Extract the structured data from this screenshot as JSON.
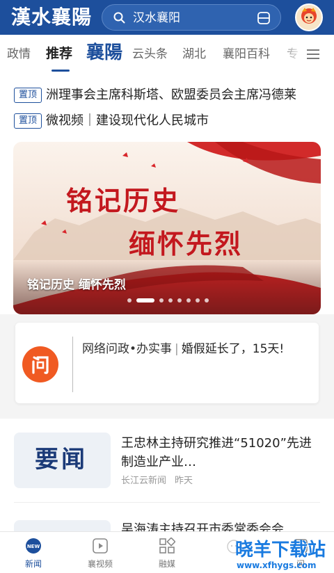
{
  "header": {
    "logo": "漢水襄陽",
    "search_text": "汉水襄阳"
  },
  "tabs": [
    {
      "label": "政情"
    },
    {
      "label": "推荐"
    },
    {
      "label": "襄陽"
    },
    {
      "label": "云头条"
    },
    {
      "label": "湖北"
    },
    {
      "label": "襄阳百科"
    },
    {
      "label": "专"
    }
  ],
  "active_tab": "推荐",
  "pinned": [
    {
      "badge": "置顶",
      "title": "洲理事会主席科斯塔、欧盟委员会主席冯德莱"
    },
    {
      "badge": "置顶",
      "title": "微视频｜建设现代化人民城市"
    }
  ],
  "banner": {
    "line1": "铭记历史",
    "line2": "缅怀先烈",
    "caption": "铭记历史 缅怀先烈",
    "slide_count": 8,
    "active_slide": 2
  },
  "wenzheng": {
    "logo_char": "问",
    "source": "网络问政•办实事",
    "separator": "|",
    "text": "婚假延长了，15天!"
  },
  "news": [
    {
      "thumb_text": "要闻",
      "title": "王忠林主持研究推进“51020”先进制造业产业…",
      "source": "长江云新闻",
      "time": "昨天"
    },
    {
      "title": "吴海涛主持召开市委常委会会"
    }
  ],
  "bottom_nav": [
    {
      "label": "新闻",
      "icon": "news-icon"
    },
    {
      "label": "襄视频",
      "icon": "play-icon"
    },
    {
      "label": "融媒",
      "icon": "grid-icon"
    },
    {
      "label": "",
      "icon": "mascot-icon"
    },
    {
      "label": "问",
      "icon": "ask-icon"
    }
  ],
  "watermark": {
    "text": "晓羊下载站",
    "url": "www.xfhygs.com"
  },
  "colors": {
    "brand_blue": "#1d4f9c",
    "banner_red": "#c3181e",
    "wenzheng_orange": "#f05a22"
  }
}
